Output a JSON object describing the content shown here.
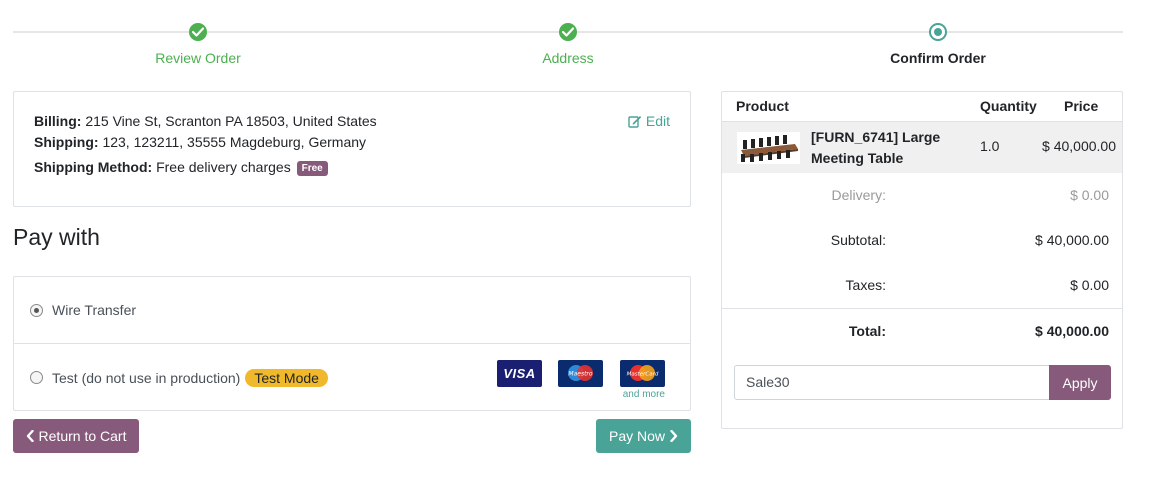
{
  "wizard": {
    "steps": [
      {
        "label": "Review Order",
        "state": "done"
      },
      {
        "label": "Address",
        "state": "done"
      },
      {
        "label": "Confirm Order",
        "state": "current"
      }
    ]
  },
  "address": {
    "billing_label": "Billing:",
    "billing_value": "215 Vine St, Scranton PA 18503, United States",
    "shipping_label": "Shipping:",
    "shipping_value": "123, 123211, 35555 Magdeburg, Germany",
    "method_label": "Shipping Method:",
    "method_value": "Free delivery charges",
    "method_badge": "Free",
    "edit_label": "Edit"
  },
  "payment": {
    "title": "Pay with",
    "options": [
      {
        "label": "Wire Transfer",
        "checked": true
      },
      {
        "label": "Test (do not use in production)",
        "checked": false,
        "badge": "Test Mode"
      }
    ],
    "card_icons": [
      "visa-icon",
      "maestro-icon",
      "mastercard-icon"
    ],
    "visa_text": "VISA",
    "and_more": "and more"
  },
  "buttons": {
    "return_label": "Return to Cart",
    "pay_label": "Pay Now"
  },
  "summary": {
    "headers": {
      "product": "Product",
      "quantity": "Quantity",
      "price": "Price"
    },
    "product": {
      "name": "[FURN_6741] Large Meeting Table",
      "quantity": "1.0",
      "price": "$ 40,000.00"
    },
    "delivery_label": "Delivery:",
    "delivery_value": "$ 0.00",
    "subtotal_label": "Subtotal:",
    "subtotal_value": "$ 40,000.00",
    "taxes_label": "Taxes:",
    "taxes_value": "$ 0.00",
    "total_label": "Total:",
    "total_value": "$ 40,000.00",
    "coupon_value": "Sale30",
    "apply_label": "Apply"
  },
  "colors": {
    "done_green": "#4caf50",
    "teal": "#4aa397",
    "purple": "#875a7b",
    "test_badge": "#f0b92b"
  }
}
